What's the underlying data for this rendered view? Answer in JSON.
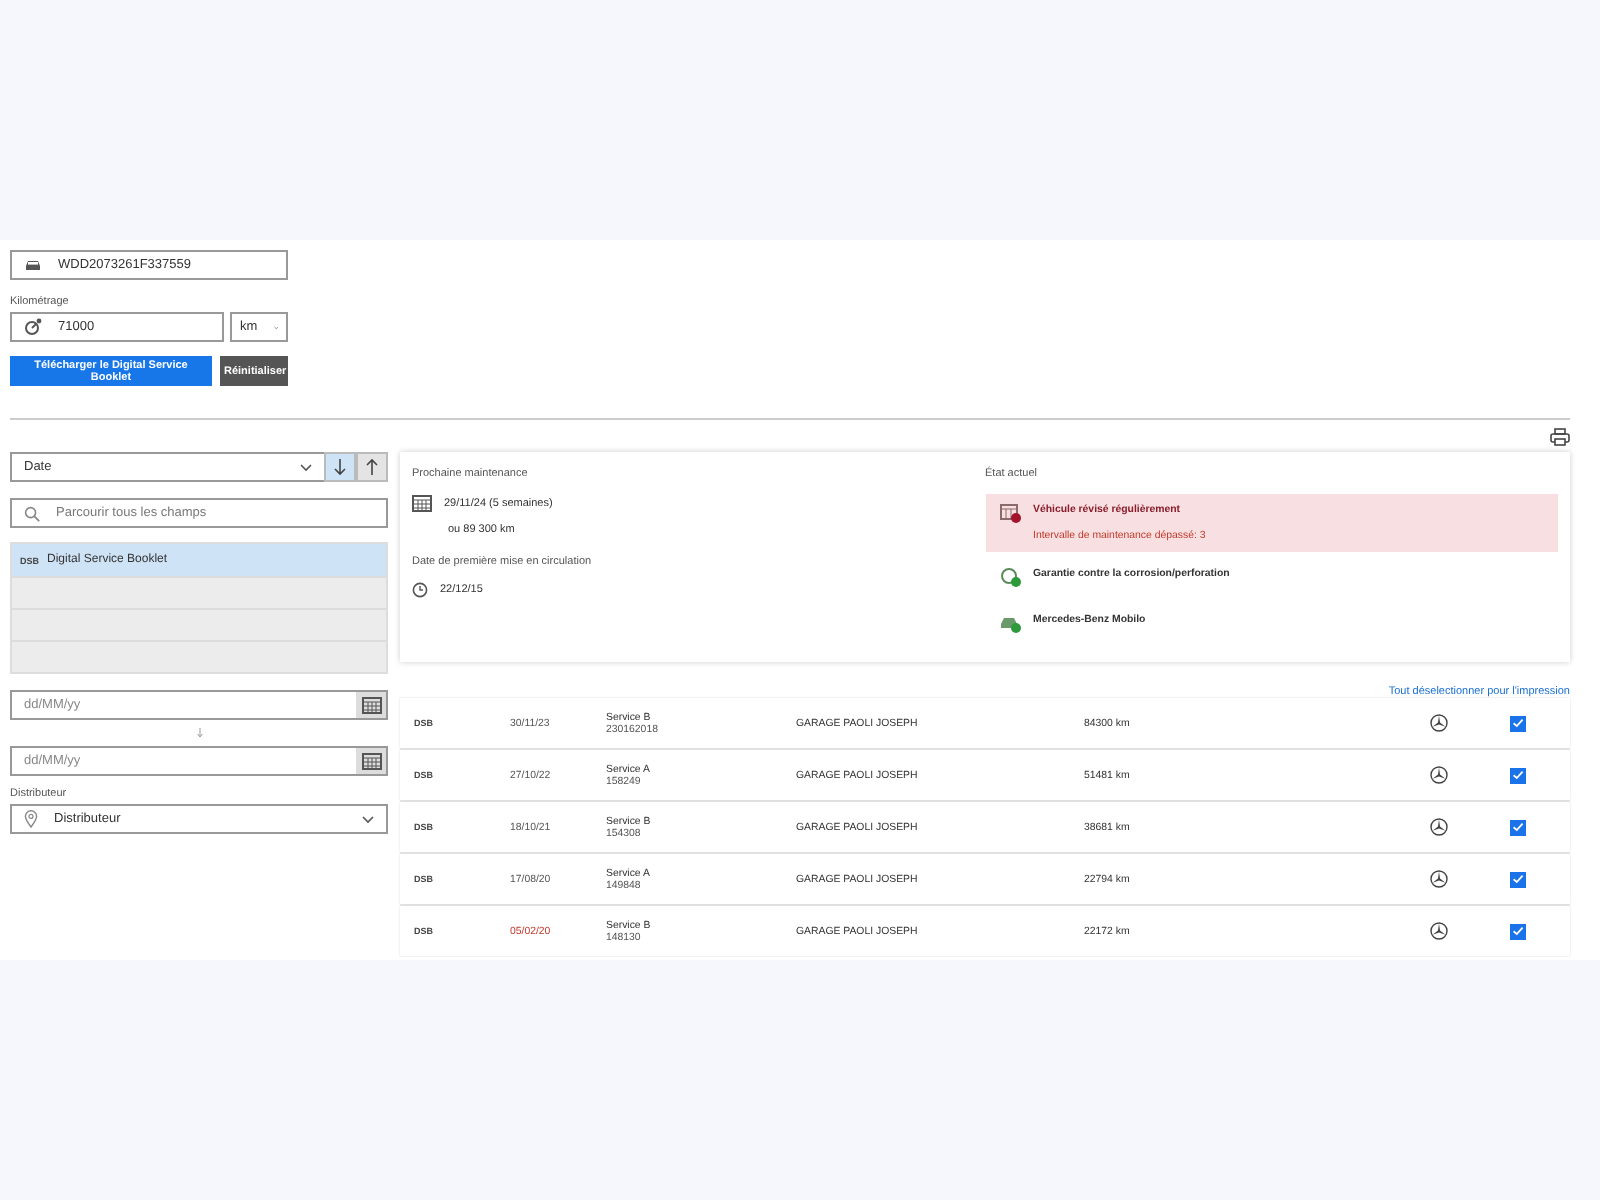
{
  "vehicle_form": {
    "vin": "WDD2073261F337559",
    "mileage": {
      "label": "Kilométrage",
      "value": "71000",
      "unit": "km"
    },
    "buttons": [
      {
        "label": "Télécharger le Digital Service Booklet",
        "kind": "primary"
      },
      {
        "label": "Réinitialiser",
        "kind": "secondary"
      }
    ]
  },
  "filters": {
    "sort": {
      "value": "Date",
      "directions": [
        {
          "kind": "descending",
          "selected": true
        },
        {
          "kind": "ascending",
          "selected": false
        }
      ]
    },
    "search": {
      "placeholder": "Parcourir tous les champs"
    },
    "sources": [
      {
        "code": "DSB",
        "label": "Digital Service Booklet",
        "selected": true
      }
    ],
    "date_from": {
      "placeholder": "dd/MM/yy"
    },
    "date_to": {
      "placeholder": "dd/MM/yy"
    },
    "distributor": {
      "label": "Distributeur",
      "placeholder": "Distributeur"
    }
  },
  "summary": {
    "next_maintenance": {
      "label": "Prochaine maintenance",
      "date": "29/11/24 (5 semaines)",
      "distance": "ou 89 300 km"
    },
    "first_registration": {
      "label": "Date de première mise en circulation",
      "date": "22/12/15"
    },
    "status": {
      "label": "État actuel",
      "items": [
        {
          "kind": "alert",
          "title": "Véhicule révisé régulièrement",
          "detail": "Intervalle de maintenance dépassé: 3"
        },
        {
          "kind": "ok",
          "title": "Garantie contre la corrosion/perforation"
        },
        {
          "kind": "ok_car",
          "title": "Mercedes-Benz Mobilo"
        }
      ]
    }
  },
  "records": {
    "deselect_link": "Tout déselectionner pour l'impression",
    "rows": [
      {
        "code": "DSB",
        "date": "30/11/23",
        "overdue": false,
        "service": "Service B",
        "number": "230162018",
        "garage": "GARAGE PAOLI JOSEPH",
        "mileage": "84300 km",
        "checked": true
      },
      {
        "code": "DSB",
        "date": "27/10/22",
        "overdue": false,
        "service": "Service A",
        "number": "158249",
        "garage": "GARAGE PAOLI JOSEPH",
        "mileage": "51481 km",
        "checked": true
      },
      {
        "code": "DSB",
        "date": "18/10/21",
        "overdue": false,
        "service": "Service B",
        "number": "154308",
        "garage": "GARAGE PAOLI JOSEPH",
        "mileage": "38681 km",
        "checked": true
      },
      {
        "code": "DSB",
        "date": "17/08/20",
        "overdue": false,
        "service": "Service A",
        "number": "149848",
        "garage": "GARAGE PAOLI JOSEPH",
        "mileage": "22794 km",
        "checked": true
      },
      {
        "code": "DSB",
        "date": "05/02/20",
        "overdue": true,
        "service": "Service B",
        "number": "148130",
        "garage": "GARAGE PAOLI JOSEPH",
        "mileage": "22172 km",
        "checked": true
      }
    ]
  }
}
